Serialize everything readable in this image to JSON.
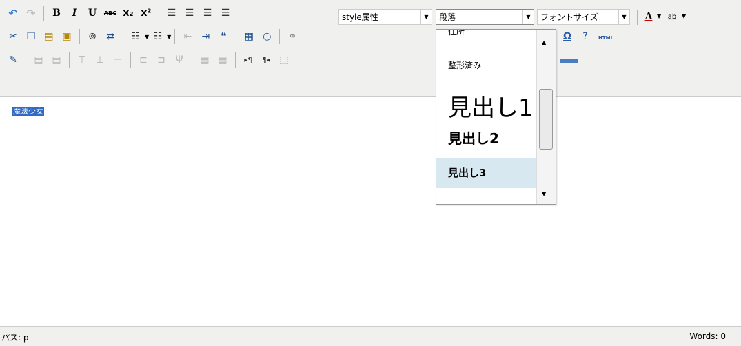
{
  "toolbar": {
    "row1": {
      "undo_icon": "undo-icon",
      "redo_icon": "redo-icon",
      "bold_label": "B",
      "italic_label": "I",
      "underline_label": "U",
      "strike_label": "ABC",
      "subscript_label": "x₂",
      "superscript_label": "x²",
      "style_select": "style属性",
      "format_select": "段落",
      "fontsize_select": "フォントサイズ",
      "font_color_label": "A",
      "highlight_label": "ab"
    },
    "row2": {
      "cut_icon": "scissors-icon",
      "copy_icon": "copy-icon",
      "paste_icon": "paste-icon",
      "paste_text_icon": "paste-text-icon",
      "find_icon": "binoculars-icon",
      "replace_icon": "replace-icon",
      "html_label": "HTML"
    },
    "row3": {
      "table_icon": "table-icon"
    }
  },
  "dropdown": {
    "partial_item": "住所",
    "items": [
      "整形済み",
      "見出し1",
      "見出し2",
      "見出し3"
    ],
    "highlighted_index": 3
  },
  "editor": {
    "selected_text": "魔法少女"
  },
  "status": {
    "path_label": "パス: p",
    "words": "Words: 0"
  },
  "colors": {
    "toolbar_bg": "#f0f0ee",
    "selection_bg": "#316ac5",
    "dropdown_highlight": "#d8e8f0",
    "icon_blue": "#1d4f91"
  }
}
